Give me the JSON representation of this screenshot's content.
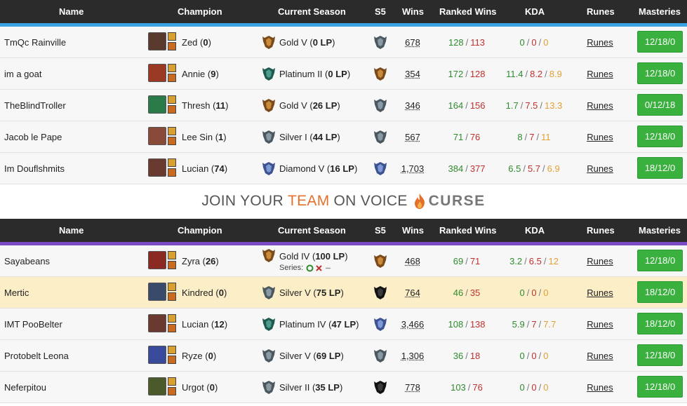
{
  "headers": {
    "name": "Name",
    "champion": "Champion",
    "season": "Current Season",
    "s5": "S5",
    "wins": "Wins",
    "ranked_wins": "Ranked Wins",
    "kda": "KDA",
    "runes": "Runes",
    "masteries": "Masteries"
  },
  "colors": {
    "team1_stripe": "#3aa3e3",
    "team2_stripe": "#7a4bc1",
    "win": "#2e8b2e",
    "loss": "#c0302f",
    "assist": "#e3a033",
    "mastery_button": "#3ab03e",
    "highlight_row": "#fcefc8"
  },
  "banner": {
    "prefix": "JOIN YOUR",
    "team_word": "TEAM",
    "suffix": "ON VOICE",
    "brand": "CURSE"
  },
  "team1": [
    {
      "name": "TmQc Rainville",
      "champion": "Zed",
      "champ_games": "0",
      "rank": "Gold V",
      "lp": "0 LP",
      "wins": "678",
      "rw": "128",
      "rl": "113",
      "k": "0",
      "d": "0",
      "a": "0",
      "runes": "Runes",
      "masteries": "12/18/0",
      "champ_icon": "zed-icon",
      "rank_tier": "gold",
      "s5_tier": "silver"
    },
    {
      "name": "im a goat",
      "champion": "Annie",
      "champ_games": "9",
      "rank": "Platinum II",
      "lp": "0 LP",
      "wins": "354",
      "rw": "172",
      "rl": "128",
      "k": "11.4",
      "d": "8.2",
      "a": "8.9",
      "runes": "Runes",
      "masteries": "12/18/0",
      "champ_icon": "annie-icon",
      "rank_tier": "platinum",
      "s5_tier": "gold"
    },
    {
      "name": "TheBlindTroller",
      "champion": "Thresh",
      "champ_games": "11",
      "rank": "Gold V",
      "lp": "26 LP",
      "wins": "346",
      "rw": "164",
      "rl": "156",
      "k": "1.7",
      "d": "7.5",
      "a": "13.3",
      "runes": "Runes",
      "masteries": "0/12/18",
      "champ_icon": "thresh-icon",
      "rank_tier": "gold",
      "s5_tier": "silver"
    },
    {
      "name": "Jacob le Pape",
      "champion": "Lee Sin",
      "champ_games": "1",
      "rank": "Silver I",
      "lp": "44 LP",
      "wins": "567",
      "rw": "71",
      "rl": "76",
      "k": "8",
      "d": "7",
      "a": "11",
      "runes": "Runes",
      "masteries": "12/18/0",
      "champ_icon": "lee-sin-icon",
      "rank_tier": "silver",
      "s5_tier": "silver"
    },
    {
      "name": "Im Douflshmits",
      "champion": "Lucian",
      "champ_games": "74",
      "rank": "Diamond V",
      "lp": "16 LP",
      "wins": "1,703",
      "rw": "384",
      "rl": "377",
      "k": "6.5",
      "d": "5.7",
      "a": "6.9",
      "runes": "Runes",
      "masteries": "18/12/0",
      "champ_icon": "lucian-icon",
      "rank_tier": "diamond",
      "s5_tier": "diamond"
    }
  ],
  "team2": [
    {
      "name": "Sayabeans",
      "champion": "Zyra",
      "champ_games": "26",
      "rank": "Gold IV",
      "lp": "100 LP",
      "series_label": "Series:",
      "wins": "468",
      "rw": "69",
      "rl": "71",
      "k": "3.2",
      "d": "6.5",
      "a": "12",
      "runes": "Runes",
      "masteries": "12/18/0",
      "champ_icon": "zyra-icon",
      "rank_tier": "gold",
      "s5_tier": "gold"
    },
    {
      "name": "Mertic",
      "champion": "Kindred",
      "champ_games": "0",
      "rank": "Silver V",
      "lp": "75 LP",
      "wins": "764",
      "rw": "46",
      "rl": "35",
      "k": "0",
      "d": "0",
      "a": "0",
      "runes": "Runes",
      "masteries": "18/12/0",
      "champ_icon": "kindred-icon",
      "rank_tier": "silver",
      "s5_tier": "unranked"
    },
    {
      "name": "IMT PooBelter",
      "champion": "Lucian",
      "champ_games": "12",
      "rank": "Platinum IV",
      "lp": "47 LP",
      "wins": "3,466",
      "rw": "108",
      "rl": "138",
      "k": "5.9",
      "d": "7",
      "a": "7.7",
      "runes": "Runes",
      "masteries": "18/12/0",
      "champ_icon": "lucian-icon",
      "rank_tier": "platinum",
      "s5_tier": "diamond"
    },
    {
      "name": "Protobelt Leona",
      "champion": "Ryze",
      "champ_games": "0",
      "rank": "Silver V",
      "lp": "69 LP",
      "wins": "1,306",
      "rw": "36",
      "rl": "18",
      "k": "0",
      "d": "0",
      "a": "0",
      "runes": "Runes",
      "masteries": "12/18/0",
      "champ_icon": "ryze-icon",
      "rank_tier": "silver",
      "s5_tier": "silver"
    },
    {
      "name": "Neferpitou",
      "champion": "Urgot",
      "champ_games": "0",
      "rank": "Silver II",
      "lp": "35 LP",
      "wins": "778",
      "rw": "103",
      "rl": "76",
      "k": "0",
      "d": "0",
      "a": "0",
      "runes": "Runes",
      "masteries": "12/18/0",
      "champ_icon": "urgot-icon",
      "rank_tier": "silver",
      "s5_tier": "unranked"
    }
  ]
}
